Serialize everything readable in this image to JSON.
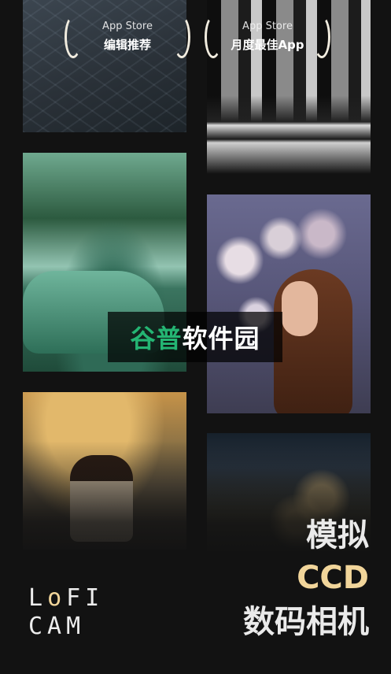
{
  "awards": [
    {
      "line1": "App Store",
      "line2": "编辑推荐"
    },
    {
      "line1": "App Store",
      "line2": "月度最佳App"
    }
  ],
  "watermark": {
    "green": "谷普",
    "white": "软件园"
  },
  "tagline": {
    "line1": "模拟",
    "line2": "CCD",
    "line3": "数码相机"
  },
  "logo": {
    "l": "L",
    "o": "o",
    "fi": "FI",
    "line2": "CAM"
  },
  "colors": {
    "accent": "#f1d59a",
    "watermark_green": "#24b573",
    "background": "#121212"
  }
}
